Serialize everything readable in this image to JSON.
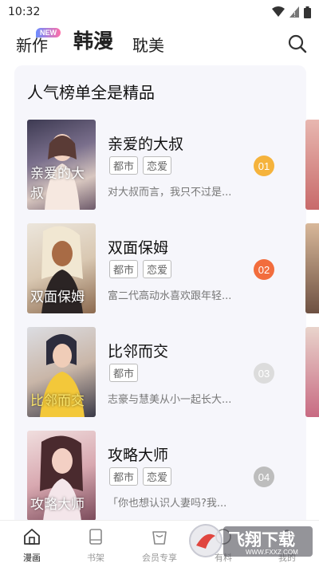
{
  "status_bar": {
    "time": "10:32"
  },
  "top_nav": {
    "tab_new": "新作",
    "new_badge": "NEW",
    "tab_korean": "韩漫",
    "tab_bl": "耽美"
  },
  "ranking": {
    "title": "人气榜单全是精品",
    "items": [
      {
        "title": "亲爱的大叔",
        "tags": [
          "都市",
          "恋爱"
        ],
        "desc": "对大叔而言，我只不过是...",
        "rank": "01",
        "rank_color": "#f5b33c",
        "cover_text": "亲爱的大叔"
      },
      {
        "title": "双面保姆",
        "tags": [
          "都市",
          "恋爱"
        ],
        "desc": "富二代高动水喜欢跟年轻...",
        "rank": "02",
        "rank_color": "#f26d3d",
        "cover_text": "双面保姆"
      },
      {
        "title": "比邻而交",
        "tags": [
          "都市"
        ],
        "desc": "志豪与慧美从小一起长大...",
        "rank": "03",
        "rank_color": "#dcdcdc",
        "cover_text": "比邻而交"
      },
      {
        "title": "攻略大师",
        "tags": [
          "都市",
          "恋爱"
        ],
        "desc": "「你也想认识人妻吗?我...",
        "rank": "04",
        "rank_color": "#bdbdbd",
        "cover_text": "攻略大师"
      }
    ]
  },
  "bottom_nav": {
    "items": [
      {
        "label": "漫画",
        "icon": "home-icon",
        "active": true
      },
      {
        "label": "书架",
        "icon": "book-icon",
        "active": false
      },
      {
        "label": "会员专享",
        "icon": "vip-bag-icon",
        "active": false
      },
      {
        "label": "有料",
        "icon": "compass-icon",
        "active": false
      },
      {
        "label": "我的",
        "icon": "user-icon",
        "active": false
      }
    ]
  },
  "watermark": {
    "text": "飞翔下载",
    "url_text": "WWW.FXXZ.COM"
  }
}
